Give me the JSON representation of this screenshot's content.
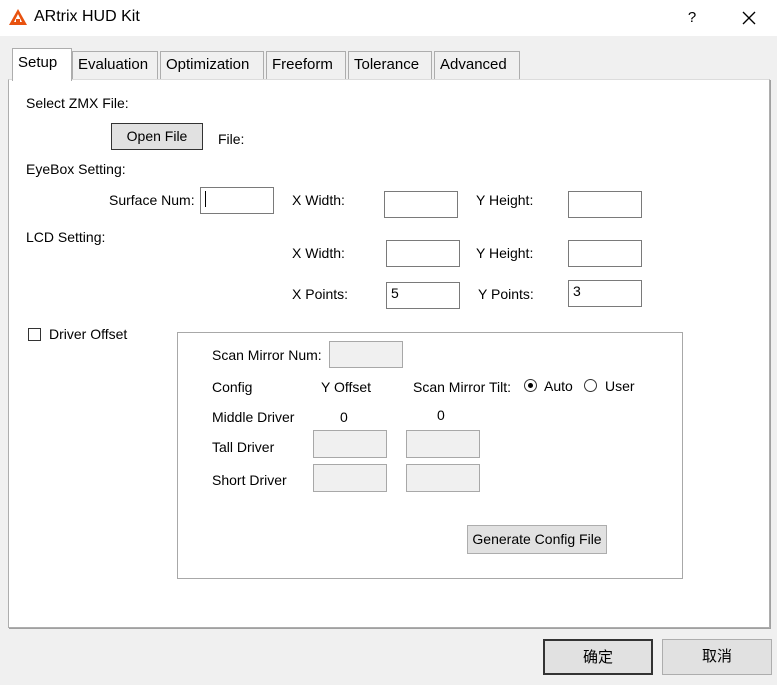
{
  "window": {
    "title": "ARtrix HUD Kit",
    "help_label": "?",
    "close_icon": "close-icon",
    "app_icon": "artrix-app-icon"
  },
  "tabs": [
    {
      "label": "Setup",
      "active": true
    },
    {
      "label": "Evaluation",
      "active": false
    },
    {
      "label": "Optimization",
      "active": false
    },
    {
      "label": "Freeform",
      "active": false
    },
    {
      "label": "Tolerance",
      "active": false
    },
    {
      "label": "Advanced",
      "active": false
    }
  ],
  "setup": {
    "zmx": {
      "section_label": "Select ZMX File:",
      "open_button": "Open File",
      "file_label": "File:"
    },
    "eyebox": {
      "section_label": "EyeBox Setting:",
      "surface_num_label": "Surface Num:",
      "surface_num_value": "",
      "x_width_label": "X Width:",
      "x_width_value": "",
      "y_height_label": "Y Height:",
      "y_height_value": ""
    },
    "lcd": {
      "section_label": "LCD Setting:",
      "x_width_label": "X Width:",
      "x_width_value": "",
      "y_height_label": "Y Height:",
      "y_height_value": "",
      "x_points_label": "X Points:",
      "x_points_value": "5",
      "y_points_label": "Y Points:",
      "y_points_value": "3"
    },
    "driver_offset": {
      "checkbox_label": "Driver Offset",
      "checked": false,
      "scan_mirror_num_label": "Scan Mirror Num:",
      "scan_mirror_num_value": "",
      "config_label": "Config",
      "y_offset_label": "Y Offset",
      "scan_mirror_tilt_label": "Scan Mirror Tilt:",
      "radio_auto_label": "Auto",
      "radio_user_label": "User",
      "selected": "Auto",
      "middle_driver_label": "Middle Driver",
      "middle_driver_y_offset": "0",
      "middle_driver_tilt": "0",
      "tall_driver_label": "Tall Driver",
      "tall_driver_y_offset": "",
      "tall_driver_tilt": "",
      "short_driver_label": "Short Driver",
      "short_driver_y_offset": "",
      "short_driver_tilt": "",
      "generate_button": "Generate Config File"
    }
  },
  "footer": {
    "ok_label": "确定",
    "cancel_label": "取消"
  },
  "colors": {
    "window_bg": "#f0f0f0",
    "panel_bg": "#ffffff",
    "border": "#adadad",
    "icon_accent": "#e8520f"
  }
}
